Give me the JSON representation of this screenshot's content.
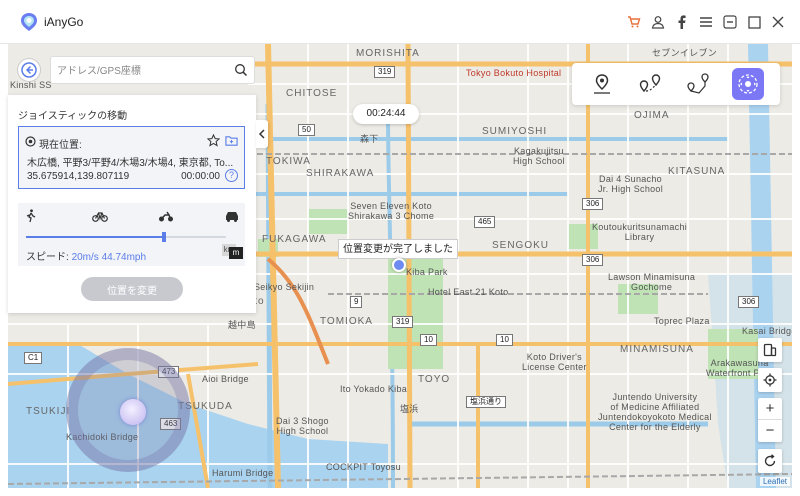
{
  "app": {
    "title": "iAnyGo"
  },
  "titlebar_icons": [
    "cart-icon",
    "user-icon",
    "facebook-icon",
    "menu-icon",
    "minimize-icon",
    "maximize-icon",
    "close-icon"
  ],
  "search": {
    "placeholder": "アドレス/GPS座標"
  },
  "panel": {
    "title": "ジョイスティックの移動",
    "location_label": "現在位置:",
    "address": "木広橋, 平野3/平野4/木場3/木場4, 東京都, To...",
    "coords": "35.675914,139.807119",
    "time": "00:00:00",
    "help": "?",
    "speed_label": "スピード: ",
    "speed_value": "20m/s 44.74mph",
    "speed_fraction": 0.69,
    "unit_km": "km",
    "unit_m": "m",
    "change_button": "位置を変更"
  },
  "timer": "00:24:44",
  "tooltip": "位置変更が完了しました",
  "accent_color": "#5b7de8",
  "mode_buttons": [
    "teleport-icon",
    "two-spot-icon",
    "multi-spot-icon",
    "joystick-icon"
  ],
  "zoom": {
    "in": "+",
    "out": "−"
  },
  "attribution": "Leaflet",
  "map": {
    "labels": [
      {
        "t": "Kinshi SS"
      },
      {
        "t": "CHITOSE"
      },
      {
        "t": "MORISHITA"
      },
      {
        "t": "TOKIWA"
      },
      {
        "t": "SHIRAKAWA"
      },
      {
        "t": "FUKAGAWA"
      },
      {
        "t": "TOMIOKA"
      },
      {
        "t": "TSUKUDA"
      },
      {
        "t": "TSUKIJI"
      },
      {
        "t": "TOYO"
      },
      {
        "t": "SENGOKU"
      },
      {
        "t": "SUMIYOSHI"
      },
      {
        "t": "OJIMA"
      },
      {
        "t": "MINAMISUNA"
      },
      {
        "t": "KITASUNA"
      },
      {
        "t": "Kagakujitsu\nHigh School"
      },
      {
        "t": "Dai 4 Sunacho\nJr. High School"
      },
      {
        "t": "Seven Eleven Koto\nShirakawa 3 Chome"
      },
      {
        "t": "Koutoukuritsunamachi\nLibrary"
      },
      {
        "t": "Lawson Minamisuna\nGochome"
      },
      {
        "t": "Toprec Plaza"
      },
      {
        "t": "Koto Driver's\nLicense Center"
      },
      {
        "t": "Juntendo University\nof Medicine Affiliated\nJuntendokoyokoto Medical\nCenter for the Elderly"
      },
      {
        "t": "Dai 3 Shogo\nHigh School"
      },
      {
        "t": "Aioi Bridge"
      },
      {
        "t": "Kachidoki Bridge"
      },
      {
        "t": "Harumi Bridge"
      },
      {
        "t": "COCKPIT Toyosu"
      },
      {
        "t": "Arakawasuna\nWaterfront Park"
      },
      {
        "t": "Hotel East 21 Koto"
      },
      {
        "t": "Kiba Park"
      },
      {
        "t": "森下"
      },
      {
        "t": "越中島"
      },
      {
        "t": "塩浜"
      },
      {
        "t": "Seikyo Sekijin"
      },
      {
        "t": "Tokyo Bokuto Hospital"
      },
      {
        "t": "セブンイレブン"
      },
      {
        "t": "Ito Yokado Kiba"
      },
      {
        "t": "Kasai Bridge"
      },
      {
        "t": "Koto"
      }
    ]
  }
}
